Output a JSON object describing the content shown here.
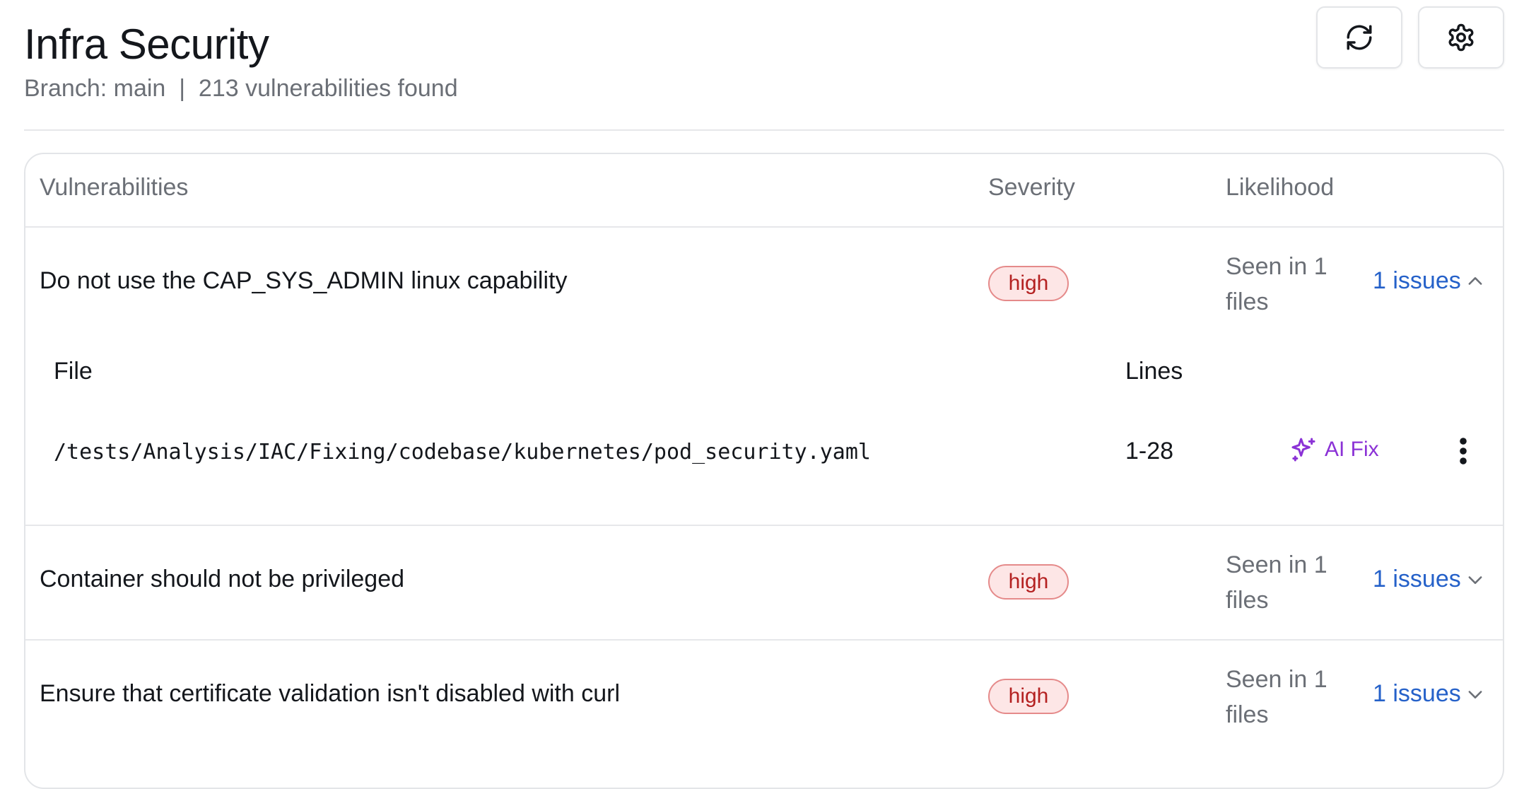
{
  "header": {
    "title": "Infra Security",
    "subtitle": "Branch: main  |  213 vulnerabilities found"
  },
  "toolbar": {
    "refresh_icon": "refresh-icon",
    "settings_icon": "gear-icon"
  },
  "table": {
    "columns": {
      "vulnerabilities": "Vulnerabilities",
      "severity": "Severity",
      "likelihood": "Likelihood"
    },
    "rows": [
      {
        "name": "Do not use the CAP_SYS_ADMIN linux capability",
        "severity": "high",
        "seen": "Seen in 1 files",
        "issues": "1 issues",
        "expanded": true
      },
      {
        "name": "Container should not be privileged",
        "severity": "high",
        "seen": "Seen in 1 files",
        "issues": "1 issues",
        "expanded": false
      },
      {
        "name": "Ensure that certificate validation isn't disabled with curl",
        "severity": "high",
        "seen": "Seen in 1 files",
        "issues": "1 issues",
        "expanded": false
      }
    ]
  },
  "detail": {
    "columns": {
      "file": "File",
      "lines": "Lines"
    },
    "files": [
      {
        "path": "/tests/Analysis/IAC/Fixing/codebase/kubernetes/pod_security.yaml",
        "lines": "1-28",
        "action": "AI Fix"
      }
    ]
  },
  "colors": {
    "severity_high_bg": "#fde6e6",
    "severity_high_border": "#e58a8a",
    "severity_high_text": "#b42121",
    "link": "#2561c9",
    "ai_fix": "#8b32d6"
  }
}
